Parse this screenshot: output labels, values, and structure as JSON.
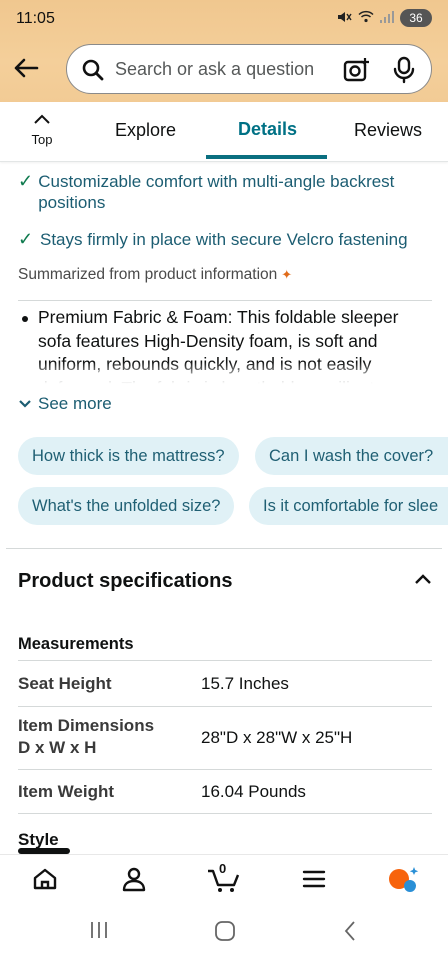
{
  "status_bar": {
    "time": "11:05",
    "battery": "36"
  },
  "search": {
    "placeholder": "Search or ask a question"
  },
  "tabs": {
    "top_label": "Top",
    "items": [
      {
        "label": "Explore"
      },
      {
        "label": "Details"
      },
      {
        "label": "Reviews"
      }
    ],
    "active": "Details"
  },
  "highlights": [
    {
      "text": "Customizable comfort with multi-angle backrest positions"
    },
    {
      "text": "Stays firmly in place with secure Velcro fastening"
    }
  ],
  "summarized_label": "Summarized from product information",
  "bullet": {
    "text": "Premium Fabric & Foam: This foldable sleeper sofa features High-Density foam, is soft and uniform, rebounds quickly, and is not easily deformed. The fabric is breathable, resilient"
  },
  "see_more_label": "See more",
  "questions": [
    {
      "label": "How thick is the mattress?"
    },
    {
      "label": "Can I wash the cover?"
    },
    {
      "label": "What's the unfolded size?"
    },
    {
      "label": "Is it comfortable for slee"
    }
  ],
  "specs": {
    "title": "Product specifications",
    "section": "Measurements",
    "rows": [
      {
        "label": "Seat Height",
        "value": "15.7 Inches"
      },
      {
        "label": "Item Dimensions D x W x H",
        "value": "28\"D x 28\"W x 25\"H"
      },
      {
        "label": "Item Weight",
        "value": "16.04 Pounds"
      }
    ],
    "next_section": "Style"
  },
  "bottom_nav": {
    "cart_count": "0",
    "accent": "#f7630c",
    "accent2": "#2a8fd6"
  },
  "colors": {
    "header_bg": "#f2cb95",
    "link_teal": "#007185",
    "chip_bg": "#e0f1f6"
  }
}
